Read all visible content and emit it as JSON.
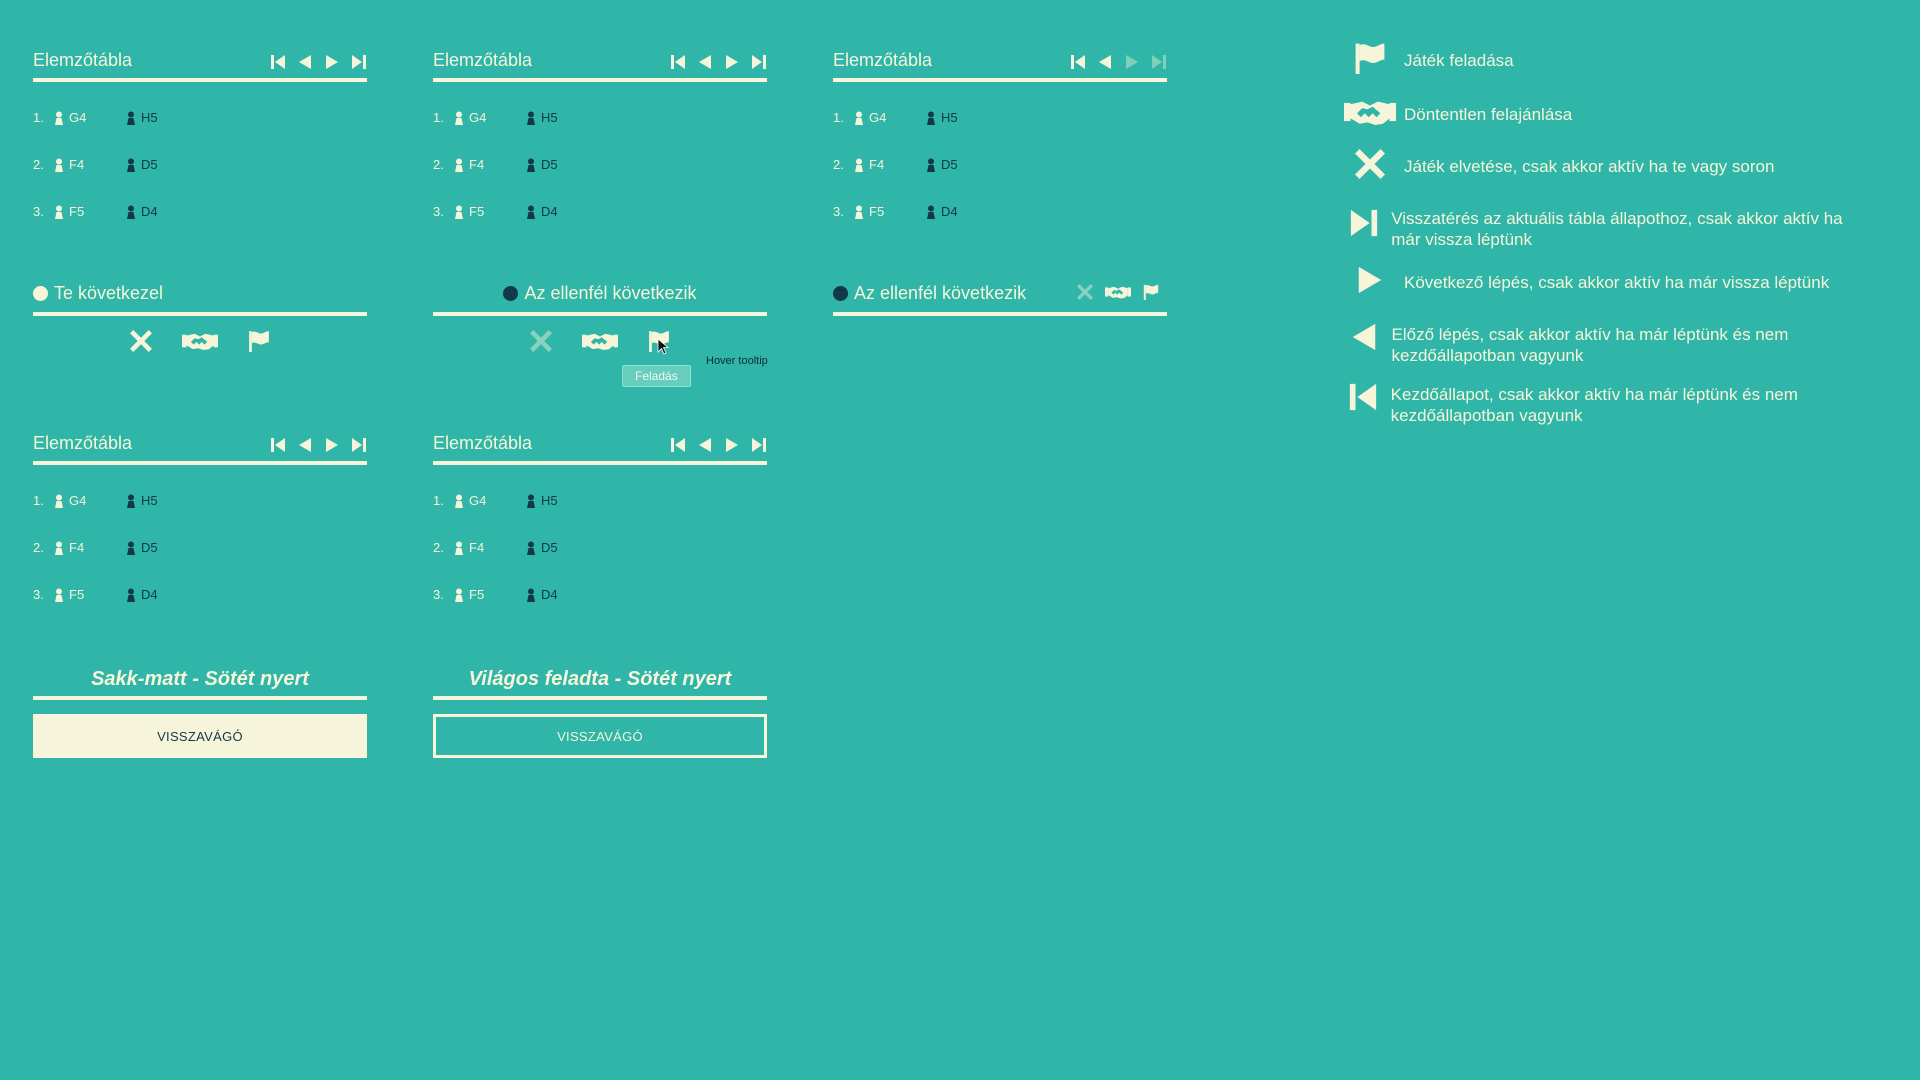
{
  "panels": {
    "title": "Elemzőtábla",
    "moves": [
      {
        "num": "1.",
        "white": "G4",
        "black": "H5"
      },
      {
        "num": "2.",
        "white": "F4",
        "black": "D5"
      },
      {
        "num": "3.",
        "white": "F5",
        "black": "D4"
      }
    ]
  },
  "status": {
    "your_turn": "Te következel",
    "opponent_turn": "Az ellenfél következik"
  },
  "tooltip": {
    "label": "Feladás",
    "note": "Hover tooltip"
  },
  "results": {
    "checkmate": "Sakk-matt - Sötét nyert",
    "resigned": "Világos feladta - Sötét nyert",
    "rematch": "VISSZAVÁGÓ"
  },
  "legend": [
    {
      "icon": "flag-icon",
      "text": "Játék feladása"
    },
    {
      "icon": "handshake-icon",
      "text": "Döntentlen felajánlása"
    },
    {
      "icon": "close-icon",
      "text": "Játék elvetése, csak akkor aktív ha te vagy soron"
    },
    {
      "icon": "skip-to-end-icon",
      "text": "Visszatérés az aktuális tábla állapothoz, csak akkor aktív ha már vissza léptünk"
    },
    {
      "icon": "play-next-icon",
      "text": "Következő lépés, csak akkor aktív ha már vissza léptünk"
    },
    {
      "icon": "previous-icon",
      "text": "Előző lépés, csak akkor aktív ha már léptünk és nem kezdőállapotban vagyunk"
    },
    {
      "icon": "skip-to-start-icon",
      "text": "Kezdőállapot, csak akkor aktív ha már léptünk és nem kezdőállapotban vagyunk"
    }
  ],
  "colors": {
    "background": "#2fb6a8",
    "light": "#f6f5d9",
    "dark": "#12384a",
    "tooltip": "#67cdbd"
  }
}
